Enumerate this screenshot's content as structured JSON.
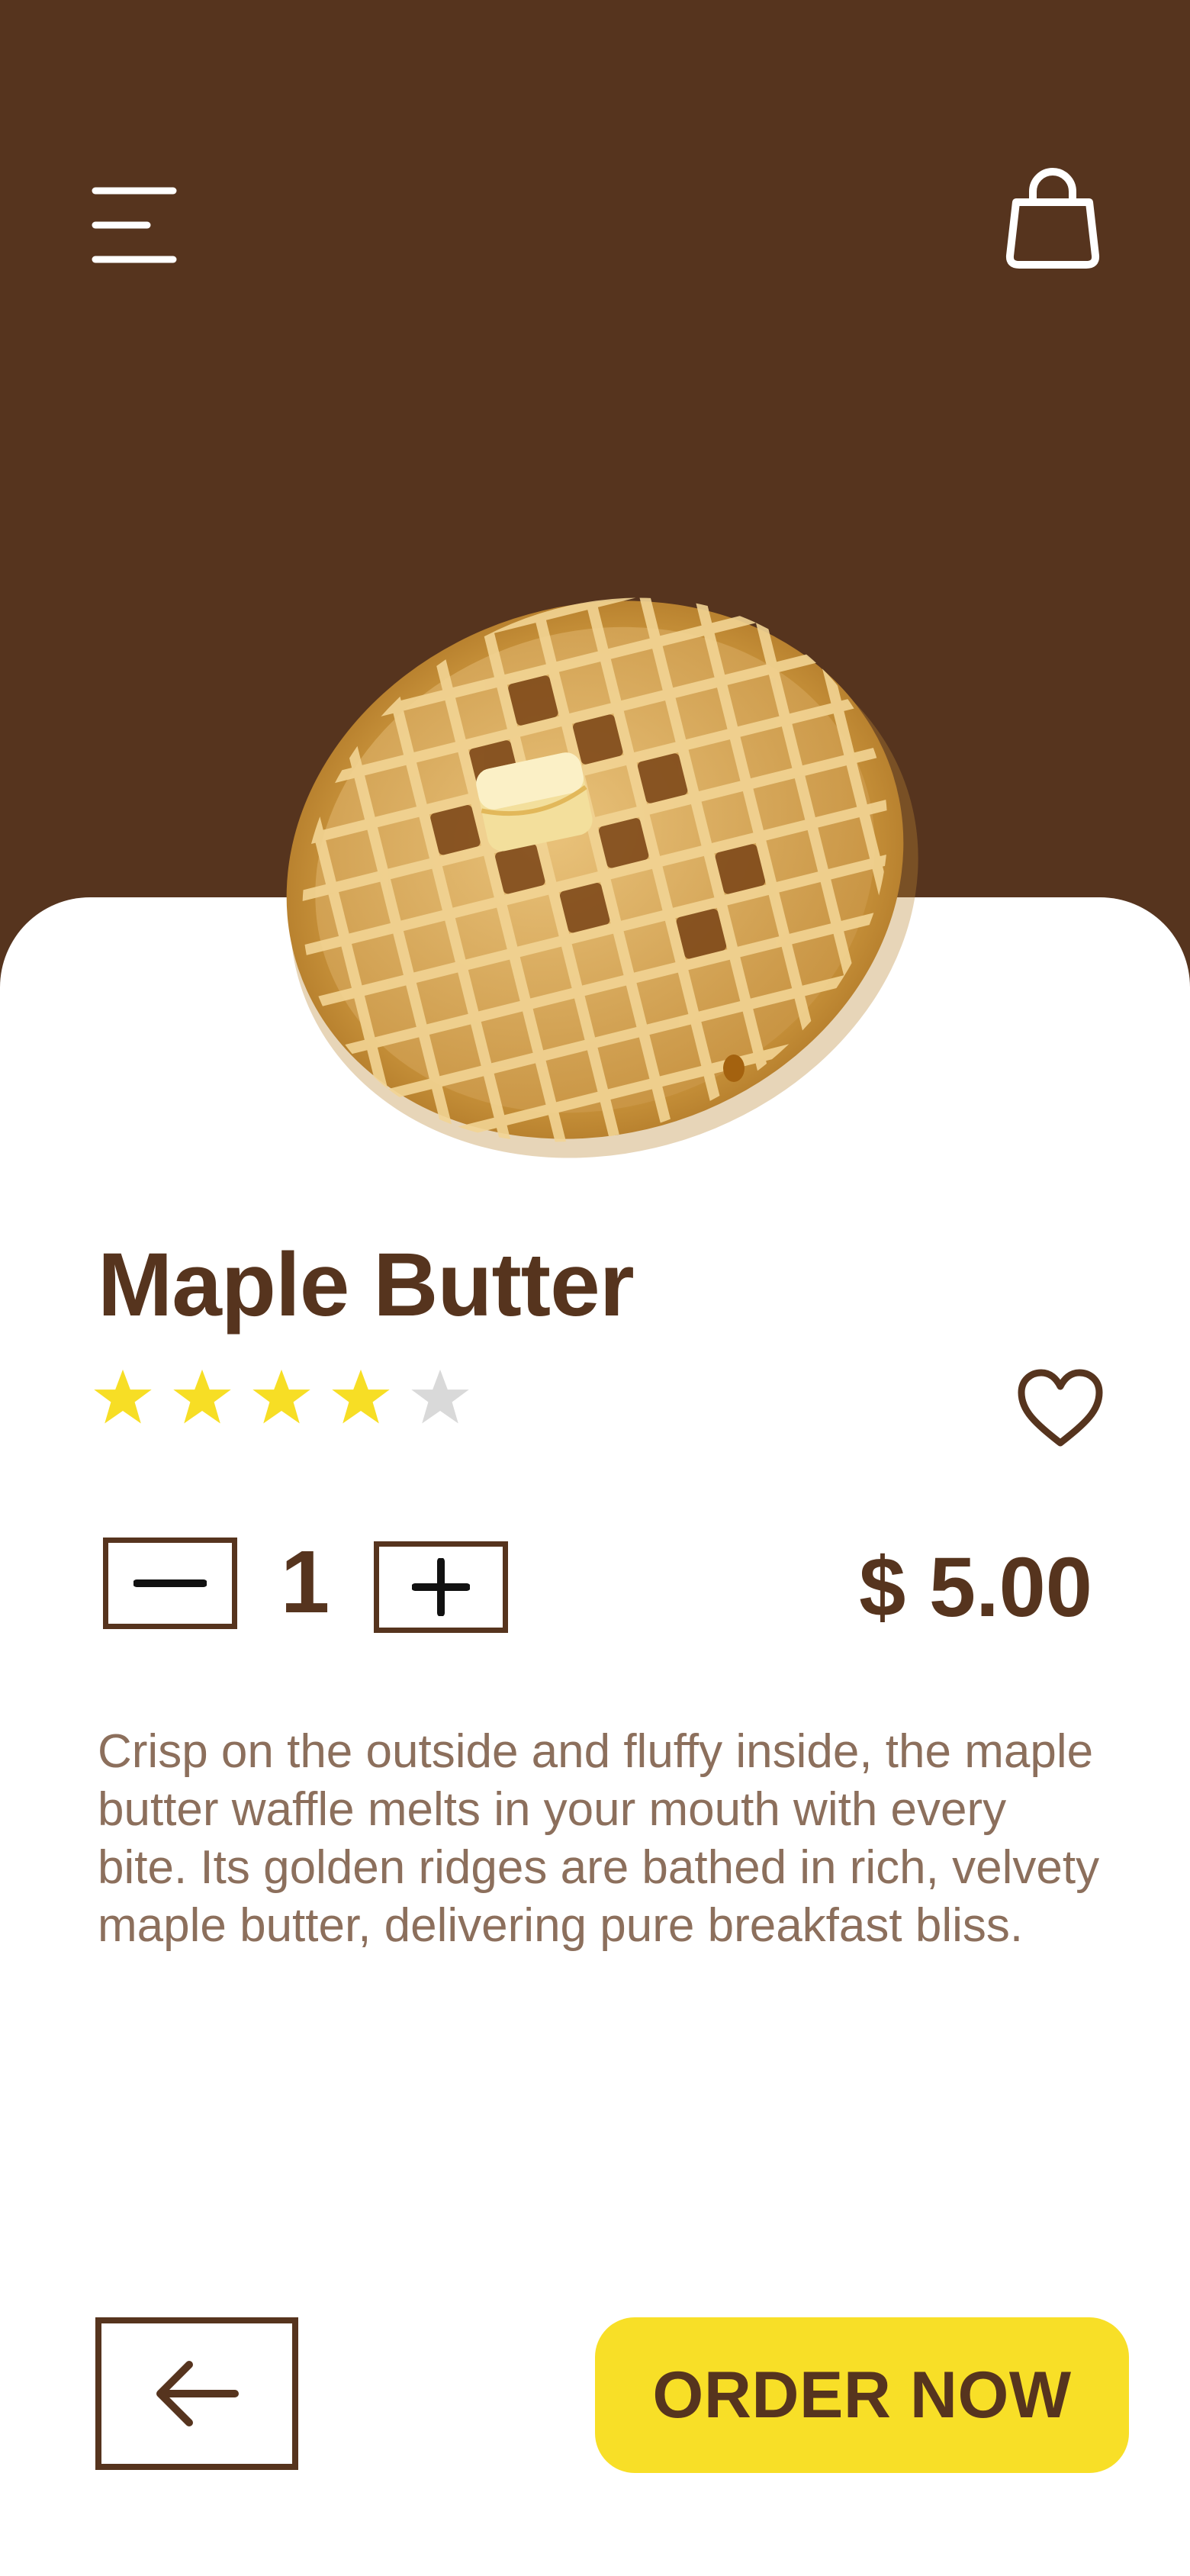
{
  "header": {
    "menu_icon": "hamburger-menu-icon",
    "bag_icon": "shopping-bag-icon"
  },
  "product": {
    "image_icon": "waffle-image",
    "name": "Maple Butter",
    "rating": 4,
    "rating_max": 5,
    "favorite_icon": "heart-outline-icon",
    "quantity": "1",
    "price": "$ 5.00",
    "description": "Crisp on the outside and fluffy inside, the maple butter waffle melts in your mouth with every bite. Its golden ridges are bathed in rich, velvety maple butter, delivering pure breakfast bliss."
  },
  "actions": {
    "back_icon": "arrow-left-icon",
    "order_label": "ORDER NOW"
  },
  "colors": {
    "brand_brown": "#56341e",
    "accent_yellow": "#f8df27",
    "star_filled": "#f7de25",
    "star_empty": "#d9d9d9",
    "description_text": "#8c6f5c",
    "background": "#ffffff"
  }
}
